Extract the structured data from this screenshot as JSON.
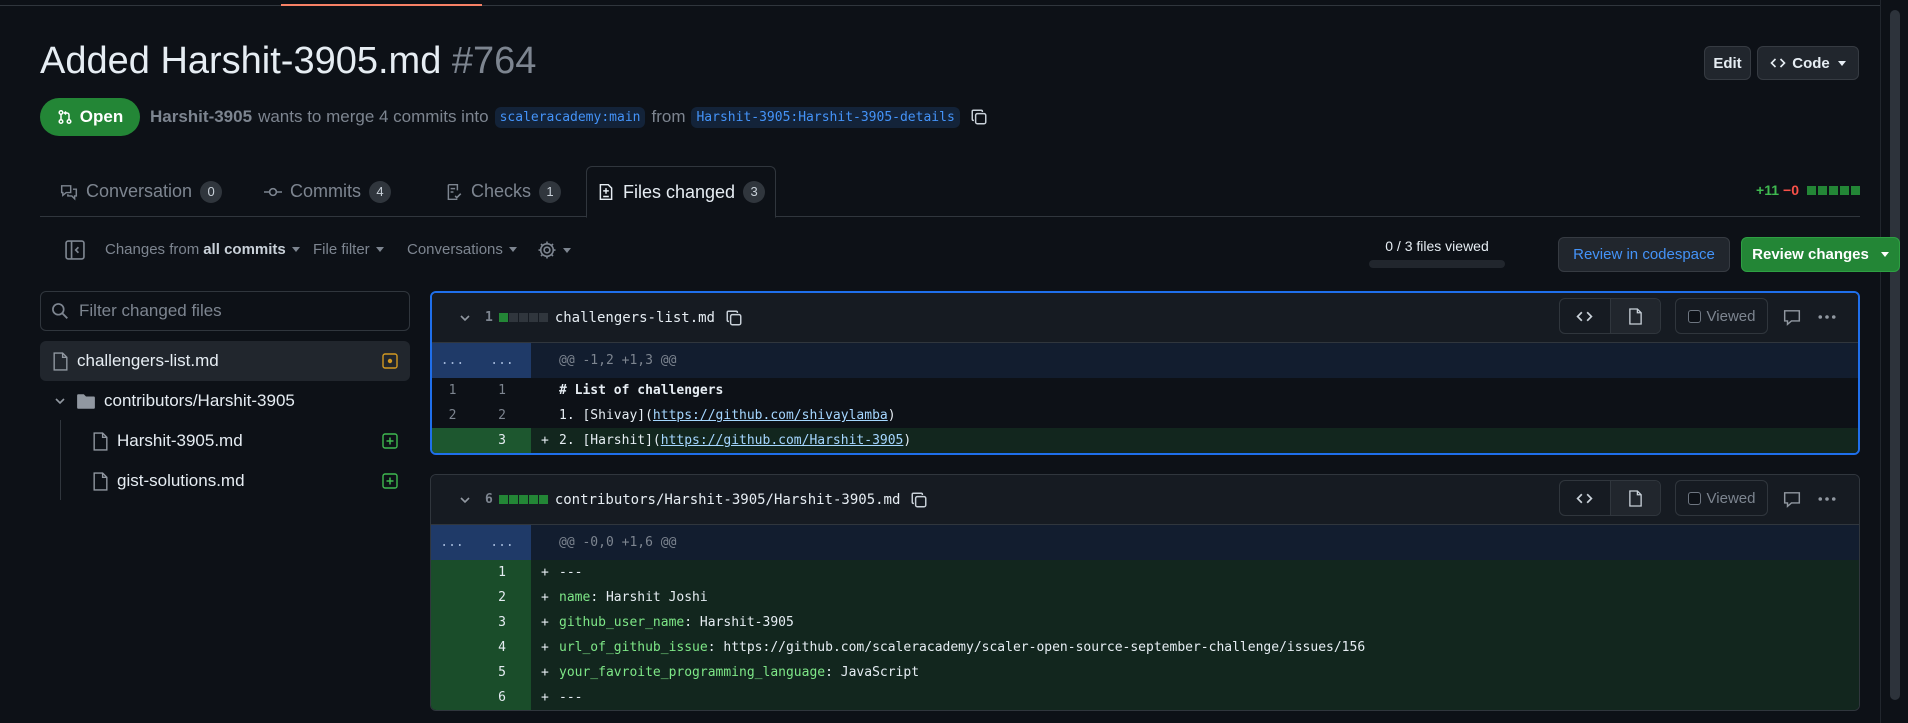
{
  "pr": {
    "title": "Added Harshit-3905.md",
    "number": "#764",
    "state": "Open",
    "author": "Harshit-3905",
    "merge_text": "wants to merge 4 commits into",
    "base_branch": "scaleracademy:main",
    "from_text": "from",
    "head_branch": "Harshit-3905:Harshit-3905-details"
  },
  "header_buttons": {
    "edit": "Edit",
    "code": "Code"
  },
  "tabs": [
    {
      "label": "Conversation",
      "count": "0"
    },
    {
      "label": "Commits",
      "count": "4"
    },
    {
      "label": "Checks",
      "count": "1"
    },
    {
      "label": "Files changed",
      "count": "3"
    }
  ],
  "diffstat": {
    "additions": "+11",
    "deletions": "−0"
  },
  "toolbar": {
    "changes_from_prefix": "Changes from",
    "changes_from_value": "all commits",
    "file_filter": "File filter",
    "conversations": "Conversations",
    "files_viewed": "0 / 3 files viewed",
    "review_codespace": "Review in codespace",
    "review_changes": "Review changes"
  },
  "file_tree": {
    "filter_placeholder": "Filter changed files",
    "items": [
      {
        "name": "challengers-list.md",
        "status": "modified"
      },
      {
        "name": "contributors/Harshit-3905",
        "type": "folder"
      },
      {
        "name": "Harshit-3905.md",
        "status": "added"
      },
      {
        "name": "gist-solutions.md",
        "status": "added"
      }
    ]
  },
  "files": [
    {
      "changed_lines": "1",
      "path": "challengers-list.md",
      "viewed_label": "Viewed",
      "hunk": {
        "left": "...",
        "right": "...",
        "header": "@@ -1,2 +1,3 @@"
      },
      "lines": [
        {
          "old": "1",
          "new": "1",
          "text": "# List of challengers"
        },
        {
          "old": "2",
          "new": "2",
          "prefix": "1. [Shivay](",
          "link": "https://github.com/shivaylamba",
          "suffix": ")"
        },
        {
          "old": "",
          "new": "3",
          "sign": "+",
          "prefix": "2. [Harshit](",
          "link": "https://github.com/Harshit-3905",
          "suffix": ")"
        }
      ]
    },
    {
      "changed_lines": "6",
      "path": "contributors/Harshit-3905/Harshit-3905.md",
      "viewed_label": "Viewed",
      "hunk": {
        "left": "...",
        "right": "...",
        "header": "@@ -0,0 +1,6 @@"
      },
      "lines": [
        {
          "new": "1",
          "sign": "+",
          "key": "",
          "value": "---"
        },
        {
          "new": "2",
          "sign": "+",
          "key": "name",
          "value": ": Harshit Joshi"
        },
        {
          "new": "3",
          "sign": "+",
          "key": "github_user_name",
          "value": ": Harshit-3905"
        },
        {
          "new": "4",
          "sign": "+",
          "key": "url_of_github_issue",
          "value": ": https://github.com/scaleracademy/scaler-open-source-september-challenge/issues/156"
        },
        {
          "new": "5",
          "sign": "+",
          "key": "your_favroite_programming_language",
          "value": ": JavaScript"
        },
        {
          "new": "6",
          "sign": "+",
          "key": "",
          "value": "---"
        }
      ]
    }
  ],
  "colors": {
    "accent_blue": "#1f6feb",
    "green": "#238636",
    "link": "#4493f8",
    "warning": "#d29922"
  }
}
